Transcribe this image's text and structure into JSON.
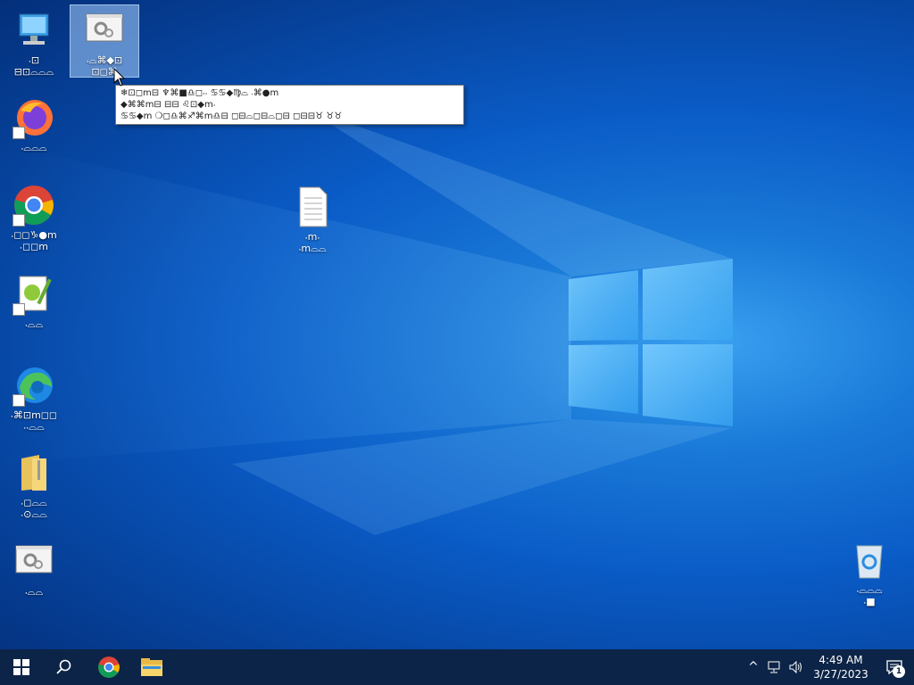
{
  "desktop": {
    "icons": [
      {
        "name": "This PC",
        "label": "⸳⊡\n⊟⊡⌓⌓⌓",
        "kind": "pc"
      },
      {
        "name": "Control Panel",
        "label": "⸳⌓⌘◆⊡\n⊡◻⌘",
        "kind": "settings",
        "selected": true
      },
      {
        "name": "Firefox",
        "label": "⸳⌓⌓⌓",
        "kind": "firefox"
      },
      {
        "name": "Google Chrome",
        "label": "⸳◻◻♑●ⅿ\n⸳◻◻ⅿ",
        "kind": "chrome"
      },
      {
        "name": "Notepad++",
        "label": "⸳⌓⌓",
        "kind": "notepad"
      },
      {
        "name": "Microsoft Edge",
        "label": "⸳⌘⊡ⅿ◻◻\n⸳⸳⌓⌓",
        "kind": "edge"
      },
      {
        "name": "Folder",
        "label": "⸳◻⌓⌓\n⸳⊙⌓⌓",
        "kind": "folder"
      },
      {
        "name": "Settings",
        "label": "⸳⌓⌓",
        "kind": "settings"
      },
      {
        "name": "Text Document",
        "label": "⸳ⅿ⸳\n⸳ⅿ⌓⌓",
        "kind": "doc"
      },
      {
        "name": "Recycle Bin",
        "label": "⸳⌓⌓⌓\n⸳■",
        "kind": "recycle"
      }
    ]
  },
  "tooltip": {
    "line1": "❄⊡◻ⅿ⊟  ♆⌘■♎◻⸳⸳  ♋♋◆♍⌓  ⸳⌘●ⅿ",
    "line2": "◆⌘⌘ⅿ⊟  ⊟⊟  ♌⊡◆ⅿ⸳",
    "line3": "♋♋◆ⅿ  ❍◻♎⌘♐⌘ⅿ♎⊟  ◻⊟⌓◻⊟⌓◻⊟  ◻⊟⊟♉  ♉♉"
  },
  "taskbar": {
    "start_icon": "windows-logo-icon",
    "search_icon": "search-icon",
    "pinned": [
      "chrome-icon",
      "file-explorer-icon"
    ],
    "tray": {
      "chevron": "^",
      "time": "4:49 AM",
      "date": "3/27/2023",
      "notification_count": "1"
    }
  },
  "colors": {
    "taskbar": "#0c2447",
    "desktop_accent": "#0a5bc6"
  }
}
